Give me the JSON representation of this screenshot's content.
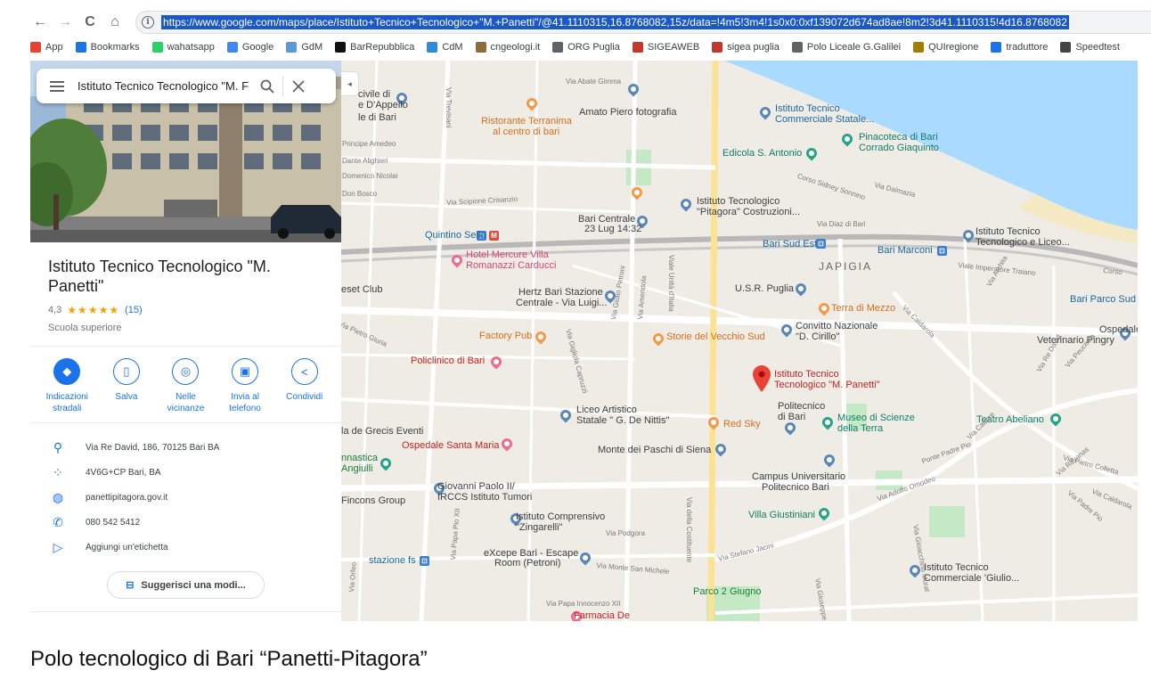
{
  "browser": {
    "url": "https://www.google.com/maps/place/Istituto+Tecnico+Tecnologico+\"M.+Panetti\"/@41.1110315,16.8768082,15z/data=!4m5!3m4!1s0x0:0xf139072d674ad8ae!8m2!3d41.1110315!4d16.8768082",
    "nav": {
      "back": "←",
      "forward": "→",
      "reload": "C",
      "home": "⌂",
      "info": "i"
    },
    "bookmarks": [
      {
        "label": "App",
        "icon": "apps-grid-icon",
        "color": "#e94235"
      },
      {
        "label": "Bookmarks",
        "icon": "star-icon",
        "color": "#1a73e8"
      },
      {
        "label": "wahatsapp",
        "icon": "whatsapp-icon",
        "color": "#25d366"
      },
      {
        "label": "Google",
        "icon": "google-icon",
        "color": "#4285f4"
      },
      {
        "label": "GdM",
        "icon": "gdm-icon",
        "color": "#5b9bd5"
      },
      {
        "label": "BarRepubblica",
        "icon": "repubblica-icon",
        "color": "#111111"
      },
      {
        "label": "CdM",
        "icon": "cdm-icon",
        "color": "#2e8bd8"
      },
      {
        "label": "cngeologi.it",
        "icon": "cngeologi-icon",
        "color": "#8a6d3b"
      },
      {
        "label": "ORG Puglia",
        "icon": "globe-icon",
        "color": "#5f6368"
      },
      {
        "label": "SIGEAWEB",
        "icon": "sigea-icon",
        "color": "#c0392b"
      },
      {
        "label": "sigea puglia",
        "icon": "sigea-icon",
        "color": "#c0392b"
      },
      {
        "label": "Polo Liceale G.Galilei",
        "icon": "globe-icon",
        "color": "#5f6368"
      },
      {
        "label": "QUIregione",
        "icon": "quiregione-icon",
        "color": "#a67c00"
      },
      {
        "label": "traduttore",
        "icon": "infinity-icon",
        "color": "#1a73e8"
      },
      {
        "label": "Speedtest",
        "icon": "speedometer-icon",
        "color": "#444444"
      }
    ]
  },
  "panel": {
    "search_value": "Istituto Tecnico Tecnologico \"M. F",
    "title": "Istituto Tecnico Tecnologico \"M. Panetti\"",
    "rating": "4,3",
    "stars": "★★★★★",
    "reviews": "(15)",
    "category": "Scuola superiore",
    "actions": [
      {
        "label": "Indicazioni stradali",
        "icon": "directions-icon",
        "glyph": "◆"
      },
      {
        "label": "Salva",
        "icon": "bookmark-icon",
        "glyph": "▯"
      },
      {
        "label": "Nelle vicinanze",
        "icon": "nearby-icon",
        "glyph": "◎"
      },
      {
        "label": "Invia al telefono",
        "icon": "send-to-phone-icon",
        "glyph": "▣"
      },
      {
        "label": "Condividi",
        "icon": "share-icon",
        "glyph": "<"
      }
    ],
    "info": [
      {
        "text": "Via Re David, 186, 70125 Bari BA",
        "icon": "location-pin-icon",
        "glyph": "⚲"
      },
      {
        "text": "4V6G+CP Bari, BA",
        "icon": "plus-code-icon",
        "glyph": "⁘"
      },
      {
        "text": "panettipitagora.gov.it",
        "icon": "website-globe-icon",
        "glyph": "◍"
      },
      {
        "text": "080 542 5412",
        "icon": "phone-icon",
        "glyph": "✆"
      },
      {
        "text": "Aggiungi un'etichetta",
        "icon": "label-tag-icon",
        "glyph": "▷"
      }
    ],
    "suggest_label": "Suggerisci una modi..."
  },
  "map": {
    "labels": [
      {
        "text": "Amato Piero fotografia",
        "cls": "dark"
      },
      {
        "text": "Ristorante Terranima",
        "cls": "orange"
      },
      {
        "text": "al centro di bari",
        "cls": "orange"
      },
      {
        "text": "Istituto Tecnico",
        "cls": "blue"
      },
      {
        "text": "Commerciale Statale...",
        "cls": "blue"
      },
      {
        "text": "Pinacoteca di Bari",
        "cls": "teal"
      },
      {
        "text": "Corrado Giaquinto",
        "cls": "teal"
      },
      {
        "text": "Edicola S. Antonio",
        "cls": "teal"
      },
      {
        "text": "Istituto Tecnologico",
        "cls": "dark"
      },
      {
        "text": "\"Pitagora\" Costruzioni...",
        "cls": "dark"
      },
      {
        "text": "Bari Centrale",
        "cls": "dark"
      },
      {
        "text": "23 Lug 14:32",
        "cls": "dark"
      },
      {
        "text": "Quintino Sella",
        "cls": "blue"
      },
      {
        "text": "Bari Sud Est",
        "cls": "blue"
      },
      {
        "text": "Bari Marconi",
        "cls": "blue"
      },
      {
        "text": "Istituto Tecnico",
        "cls": "dark"
      },
      {
        "text": "Tecnologico e Liceo...",
        "cls": "dark"
      },
      {
        "text": "Hotel Mercure Villa",
        "cls": "pink"
      },
      {
        "text": "Romanazzi Carducci",
        "cls": "pink"
      },
      {
        "text": "JAPIGIA",
        "cls": "big"
      },
      {
        "text": "Bari Parco Sud",
        "cls": "blue"
      },
      {
        "text": "Hertz Bari Stazione",
        "cls": "dark"
      },
      {
        "text": "Centrale - Via Luigi...",
        "cls": "dark"
      },
      {
        "text": "U.S.R. Puglia",
        "cls": "dark"
      },
      {
        "text": "Terra di Mezzo",
        "cls": "orange"
      },
      {
        "text": "Convitto Nazionale",
        "cls": "dark"
      },
      {
        "text": "\"D. Cirillo\"",
        "cls": "dark"
      },
      {
        "text": "Ospedale",
        "cls": "dark"
      },
      {
        "text": "Veterinario Pingry",
        "cls": "dark"
      },
      {
        "text": "Factory Pub",
        "cls": "orange"
      },
      {
        "text": "Storie del Vecchio Sud",
        "cls": "orange"
      },
      {
        "text": "Policlinico di Bari",
        "cls": "red"
      },
      {
        "text": "Istituto Tecnico",
        "cls": "red"
      },
      {
        "text": "Tecnologico \"M. Panetti\"",
        "cls": "red"
      },
      {
        "text": "Politecnico",
        "cls": "dark"
      },
      {
        "text": "di Bari",
        "cls": "dark"
      },
      {
        "text": "Museo di Scienze",
        "cls": "teal"
      },
      {
        "text": "della Terra",
        "cls": "teal"
      },
      {
        "text": "Teatro Abeliano",
        "cls": "teal"
      },
      {
        "text": "Liceo Artistico",
        "cls": "dark"
      },
      {
        "text": "Statale \" G. De Nittis\"",
        "cls": "dark"
      },
      {
        "text": "Red Sky",
        "cls": "orange"
      },
      {
        "text": "Ospedale Santa Maria",
        "cls": "red"
      },
      {
        "text": "Monte dei Paschi di Siena",
        "cls": "dark"
      },
      {
        "text": "Campus Universitario",
        "cls": "dark"
      },
      {
        "text": "Politecnico Bari",
        "cls": "dark"
      },
      {
        "text": "Giovanni Paolo II/",
        "cls": "dark"
      },
      {
        "text": "IRCCS Istituto Tumori",
        "cls": "dark"
      },
      {
        "text": "Villa Giustiniani",
        "cls": "teal"
      },
      {
        "text": "Istituto Comprensivo",
        "cls": "dark"
      },
      {
        "text": "\"Zingarelli\"",
        "cls": "dark"
      },
      {
        "text": "eXcepe Bari - Escape",
        "cls": "dark"
      },
      {
        "text": "Room (Petroni)",
        "cls": "dark"
      },
      {
        "text": "stazione fs",
        "cls": "blue"
      },
      {
        "text": "Istituto Tecnico",
        "cls": "dark"
      },
      {
        "text": "Commerciale 'Giulio...",
        "cls": "dark"
      },
      {
        "text": "Parco 2 Giugno",
        "cls": "green"
      },
      {
        "text": "Farmacia De",
        "cls": "red"
      },
      {
        "text": "civile di",
        "cls": "dark"
      },
      {
        "text": "e D'Appello",
        "cls": "dark"
      },
      {
        "text": "le di Bari",
        "cls": "dark"
      },
      {
        "text": "eset Club",
        "cls": "dark"
      },
      {
        "text": "la de Grecis Eventi",
        "cls": "dark"
      },
      {
        "text": "nnastica",
        "cls": "green"
      },
      {
        "text": "Angiulli",
        "cls": "green"
      },
      {
        "text": "Fincons Group",
        "cls": "dark"
      }
    ],
    "streets": [
      "Via Abate Gimma",
      "Via Trevisani",
      "Principe Amedeo",
      "Dante Alighieri",
      "Domenico Nicolai",
      "Don Bosco",
      "Via Scipione Crisanzio",
      "Corso Sidney Sonnino",
      "Via Dalmazia",
      "Via Diaz di Bari",
      "Viale Imperatore Traiano",
      "Corso",
      "Viale Unità d'Italia",
      "Via Pietro Giuria",
      "Via Caldarola",
      "Via Archita",
      "Via Gigliola Capruzzi",
      "Via Giulio Petroni",
      "Via Amendola",
      "Via Peucezia",
      "Via Re David",
      "Via Cadore",
      "Via Pietro Colletta",
      "Via Ravanas",
      "Via Padre Pio",
      "Via Adolfo Omodeo",
      "Ponte Padre Pio",
      "Via della Costituente",
      "Via Stefano Jacini",
      "Via Giuseppe Fanelli",
      "Via Gioacchino Murat",
      "Via Papa Innocenzo XII",
      "Via Papa Pio XII",
      "Via Monte San Michele",
      "Via Podgora",
      "Via Orfeo",
      "Via Caldarola"
    ]
  },
  "caption": "Polo tecnologico di Bari “Panetti-Pitagora”"
}
